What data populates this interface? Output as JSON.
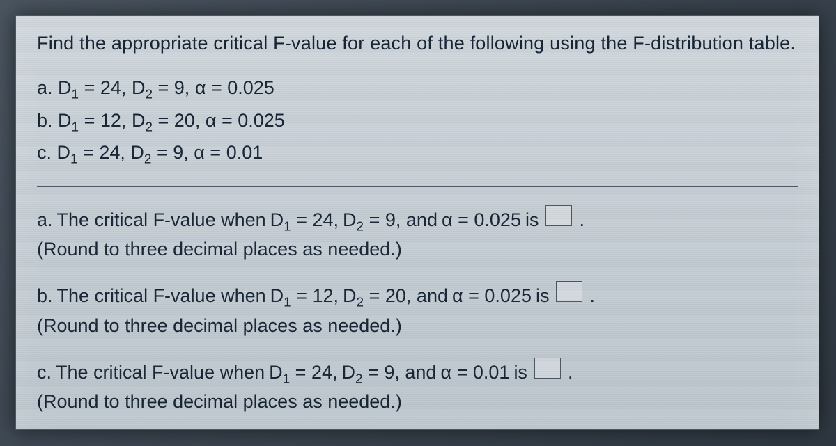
{
  "prompt": "Find the appropriate critical F-value for each of the following using the F-distribution table.",
  "given": {
    "a": {
      "label": "a.",
      "d1": "24",
      "d2": "9",
      "alpha": "0.025"
    },
    "b": {
      "label": "b.",
      "d1": "12",
      "d2": "20",
      "alpha": "0.025"
    },
    "c": {
      "label": "c.",
      "d1": "24",
      "d2": "9",
      "alpha": "0.01"
    }
  },
  "answers": {
    "a": {
      "label": "a.",
      "pre": "The critical F-value when",
      "d1": "24",
      "d2": "9",
      "alpha": "0.025",
      "post": "is",
      "round": "(Round to three decimal places as needed.)"
    },
    "b": {
      "label": "b.",
      "pre": "The critical F-value when",
      "d1": "12",
      "d2": "20",
      "alpha": "0.025",
      "post": "is",
      "round": "(Round to three decimal places as needed.)"
    },
    "c": {
      "label": "c.",
      "pre": "The critical F-value when",
      "d1": "24",
      "d2": "9",
      "alpha": "0.01",
      "post": "is",
      "round": "(Round to three decimal places as needed.)"
    }
  },
  "symbols": {
    "D1": "D",
    "sub1": "1",
    "D2": "D",
    "sub2": "2",
    "alpha": "α",
    "eq": "=",
    "comma_and": ", and",
    "period": "."
  }
}
